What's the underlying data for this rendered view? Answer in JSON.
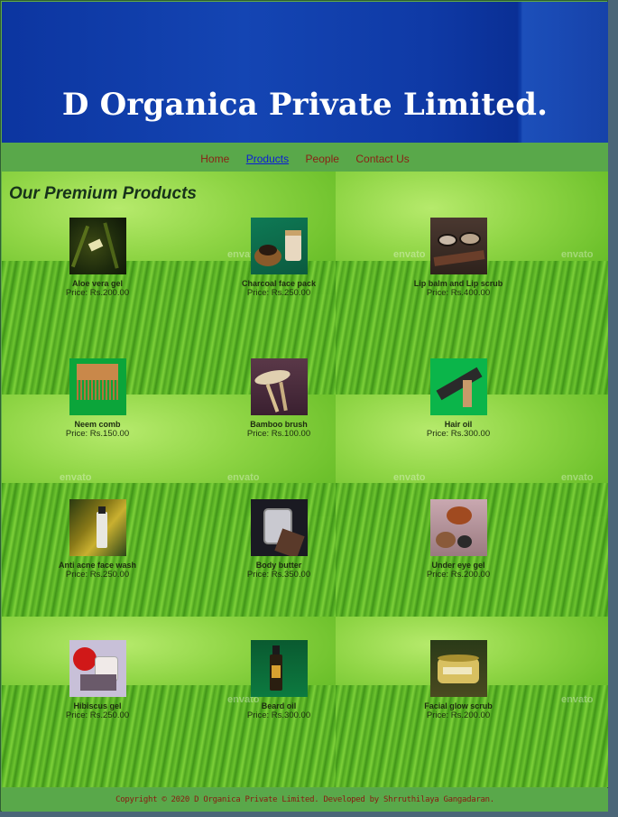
{
  "header": {
    "title": "D Organica Private Limited."
  },
  "nav": {
    "items": [
      {
        "label": "Home"
      },
      {
        "label": "Products"
      },
      {
        "label": "People"
      },
      {
        "label": "Contact Us"
      }
    ]
  },
  "main": {
    "heading": "Our Premium Products",
    "watermark": "envato",
    "products": [
      {
        "name": "Aloe vera gel",
        "price": "Price: Rs.200.00"
      },
      {
        "name": "Charcoal face pack",
        "price": "Price: Rs.250.00"
      },
      {
        "name": "Lip balm and Lip scrub",
        "price": "Price: Rs.400.00"
      },
      {
        "name": "Neem comb",
        "price": "Price: Rs.150.00"
      },
      {
        "name": "Bamboo brush",
        "price": "Price: Rs.100.00"
      },
      {
        "name": "Hair oil",
        "price": "Price: Rs.300.00"
      },
      {
        "name": "Anti acne face wash",
        "price": "Price: Rs.250.00"
      },
      {
        "name": "Body butter",
        "price": "Price: Rs.350.00"
      },
      {
        "name": "Under eye gel",
        "price": "Price: Rs.200.00"
      },
      {
        "name": "Hibiscus gel",
        "price": "Price: Rs.250.00"
      },
      {
        "name": "Beard oil",
        "price": "Price: Rs.300.00"
      },
      {
        "name": "Facial glow scrub",
        "price": "Price: Rs.200.00"
      }
    ]
  },
  "footer": {
    "copyright": "Copyright © 2020 D Organica Private Limited. Developed by Shrruthilaya Gangadaran."
  },
  "colors": {
    "header_blue": "#0c35a0",
    "nav_green": "#59a84a",
    "nav_link": "#8a2216",
    "active_link": "#0a1cd8"
  }
}
